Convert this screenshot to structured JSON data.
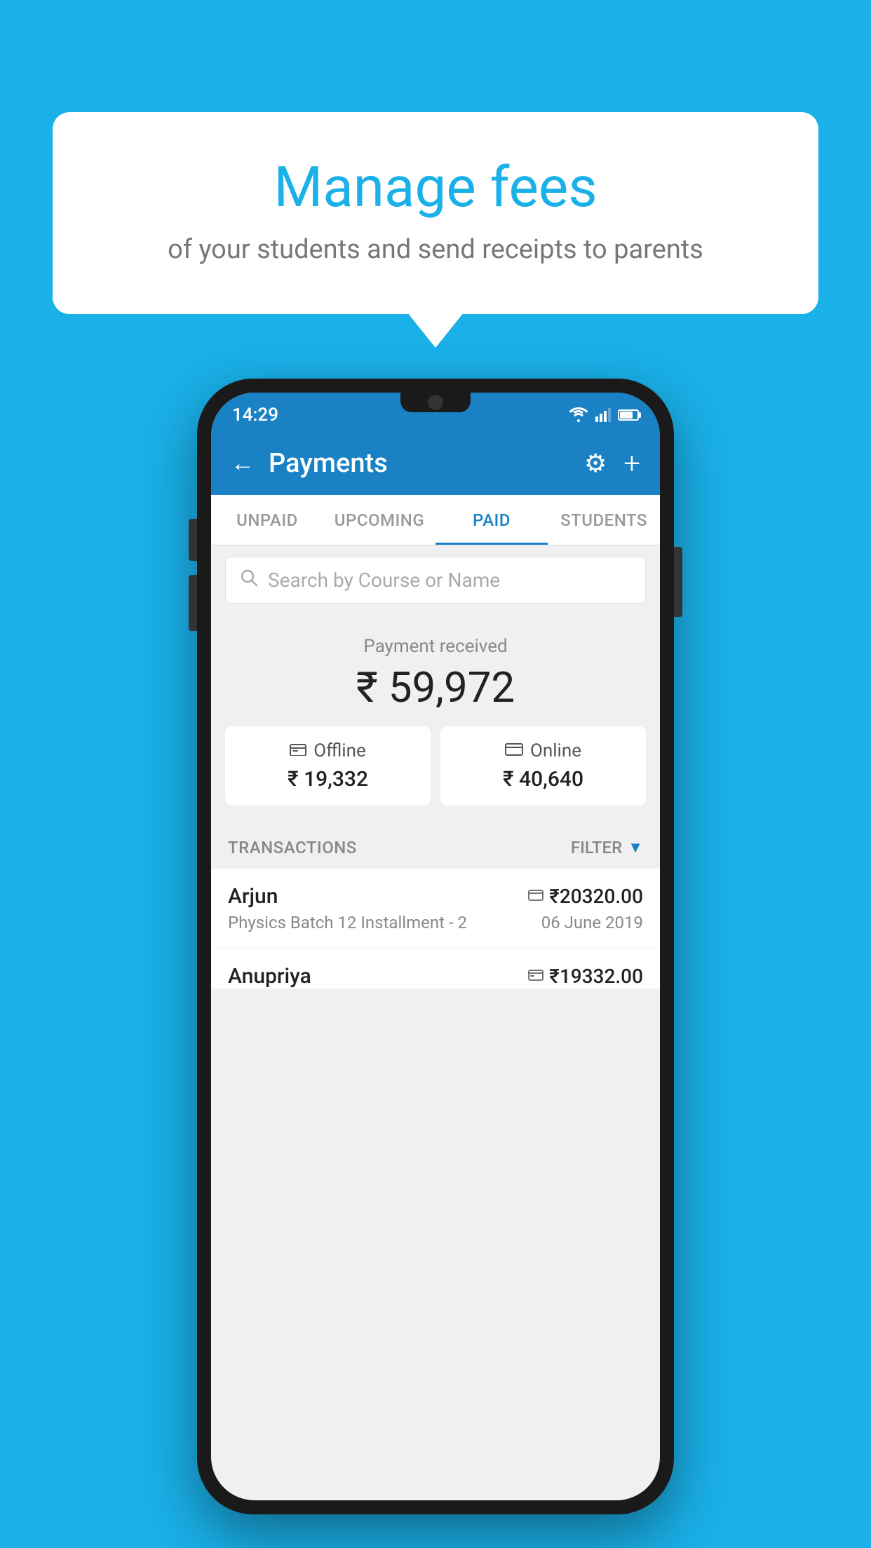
{
  "background_color": "#1ab0e8",
  "speech_bubble": {
    "title": "Manage fees",
    "subtitle": "of your students and send receipts to parents"
  },
  "status_bar": {
    "time": "14:29"
  },
  "app_bar": {
    "title": "Payments",
    "back_label": "←",
    "gear_label": "⚙",
    "plus_label": "+"
  },
  "tabs": [
    {
      "label": "UNPAID",
      "active": false
    },
    {
      "label": "UPCOMING",
      "active": false
    },
    {
      "label": "PAID",
      "active": true
    },
    {
      "label": "STUDENTS",
      "active": false
    }
  ],
  "search": {
    "placeholder": "Search by Course or Name"
  },
  "payment_received": {
    "label": "Payment received",
    "amount": "₹ 59,972",
    "offline_label": "Offline",
    "offline_amount": "₹ 19,332",
    "online_label": "Online",
    "online_amount": "₹ 40,640"
  },
  "transactions_section": {
    "label": "TRANSACTIONS",
    "filter_label": "FILTER"
  },
  "transactions": [
    {
      "name": "Arjun",
      "course": "Physics Batch 12 Installment - 2",
      "amount": "₹20320.00",
      "date": "06 June 2019",
      "payment_type": "online"
    },
    {
      "name": "Anupriya",
      "course": "",
      "amount": "₹19332.00",
      "date": "",
      "payment_type": "offline"
    }
  ]
}
